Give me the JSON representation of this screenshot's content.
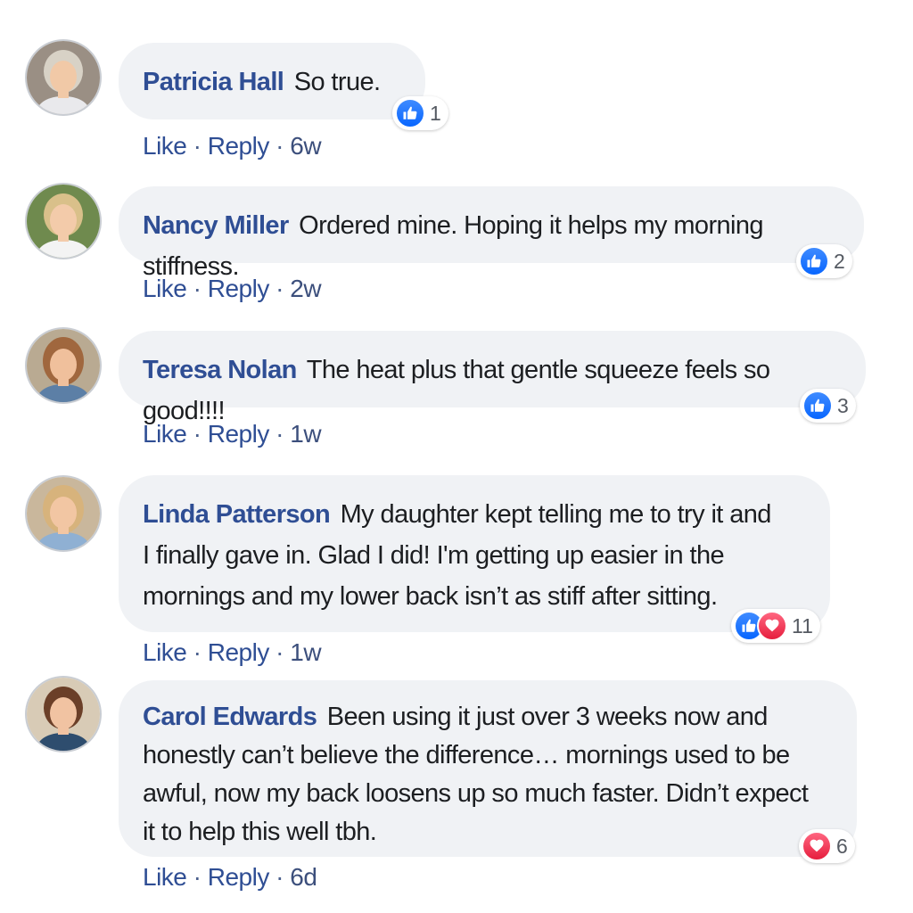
{
  "comments": [
    {
      "author": "Patricia Hall",
      "text": "So true.",
      "reaction_count": "1",
      "reactions": [
        "like-icon"
      ],
      "like_label": "Like",
      "reply_label": "Reply",
      "separator": "·",
      "time": "6w"
    },
    {
      "author": "Nancy Miller",
      "text": "Ordered mine. Hoping it helps my morning stiffness.",
      "reaction_count": "2",
      "reactions": [
        "like-icon"
      ],
      "like_label": "Like",
      "reply_label": "Reply",
      "separator": "·",
      "time": "2w"
    },
    {
      "author": "Teresa Nolan",
      "text": "The heat plus that gentle squeeze feels so good!!!!",
      "reaction_count": "3",
      "reactions": [
        "like-icon"
      ],
      "like_label": "Like",
      "reply_label": "Reply",
      "separator": "·",
      "time": "1w"
    },
    {
      "author": "Linda Patterson",
      "text": "My daughter kept telling me to try it and I finally gave in. Glad I did! I'm getting up easier in the mornings and my lower back isn’t as stiff after sitting.",
      "reaction_count": "11",
      "reactions": [
        "like-icon",
        "heart-icon"
      ],
      "like_label": "Like",
      "reply_label": "Reply",
      "separator": "·",
      "time": "1w"
    },
    {
      "author": "Carol Edwards",
      "text": "Been using it just over 3 weeks now and honestly can’t believe the difference… mornings used to be awful, now my back loosens up so much faster. Didn’t expect it to help this well tbh.",
      "reaction_count": "6",
      "reactions": [
        "heart-icon"
      ],
      "like_label": "Like",
      "reply_label": "Reply",
      "separator": "·",
      "time": "6d"
    }
  ],
  "colors": {
    "author": "#2f4e94",
    "bubble": "#f0f2f5",
    "like": "#0866ff",
    "love": "#e61e3d"
  }
}
